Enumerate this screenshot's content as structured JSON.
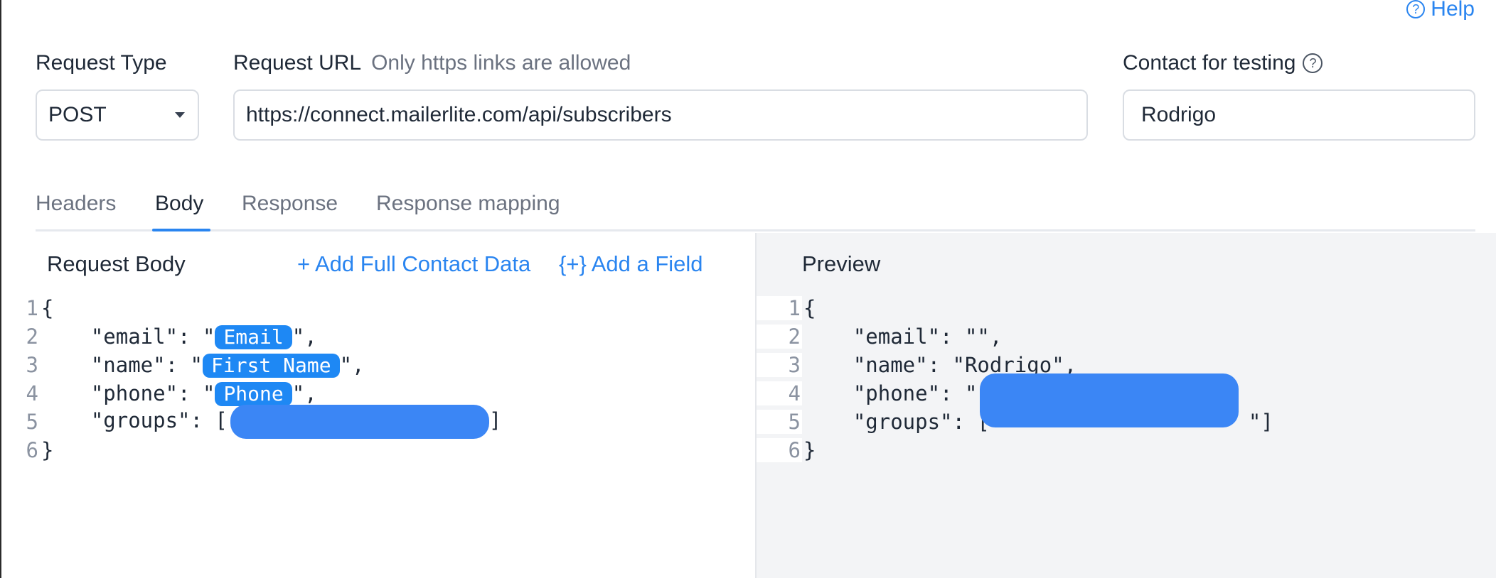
{
  "help": {
    "label": "Help"
  },
  "form": {
    "request_type": {
      "label": "Request Type",
      "value": "POST"
    },
    "request_url": {
      "label": "Request URL",
      "hint": "Only https links are allowed",
      "value": "https://connect.mailerlite.com/api/subscribers"
    },
    "contact": {
      "label": "Contact for testing",
      "value": "Rodrigo"
    }
  },
  "tabs": [
    {
      "label": "Headers"
    },
    {
      "label": "Body",
      "active": true
    },
    {
      "label": "Response"
    },
    {
      "label": "Response mapping"
    }
  ],
  "request_body": {
    "title": "Request Body",
    "add_full_contact": "+ Add Full Contact Data",
    "add_field": "{+} Add a Field",
    "line_numbers": [
      "1",
      "2",
      "3",
      "4",
      "5",
      "6"
    ],
    "lines": {
      "l1": "{",
      "l2_pre": "    \"email\": \"",
      "l2_chip": "Email",
      "l2_post": "\",",
      "l3_pre": "    \"name\": \"",
      "l3_chip": "First Name",
      "l3_post": "\",",
      "l4_pre": "    \"phone\": \"",
      "l4_chip": "Phone",
      "l4_post": "\",",
      "l5_pre": "    \"groups\": [",
      "l5_post": "]",
      "l6": "}"
    }
  },
  "preview": {
    "title": "Preview",
    "line_numbers": [
      "1",
      "2",
      "3",
      "4",
      "5",
      "6"
    ],
    "lines": {
      "l1": "{",
      "l2": "    \"email\": \"\",",
      "l3": "    \"name\": \"Rodrigo\",",
      "l4": "    \"phone\": \"",
      "l5_pre": "    \"groups\": [",
      "l5_post": "\"]",
      "l6": "}"
    }
  },
  "colors": {
    "accent": "#2a85f0",
    "chip": "#1e88f4",
    "redaction": "#3b86f5",
    "preview_bg": "#f3f4f6"
  }
}
